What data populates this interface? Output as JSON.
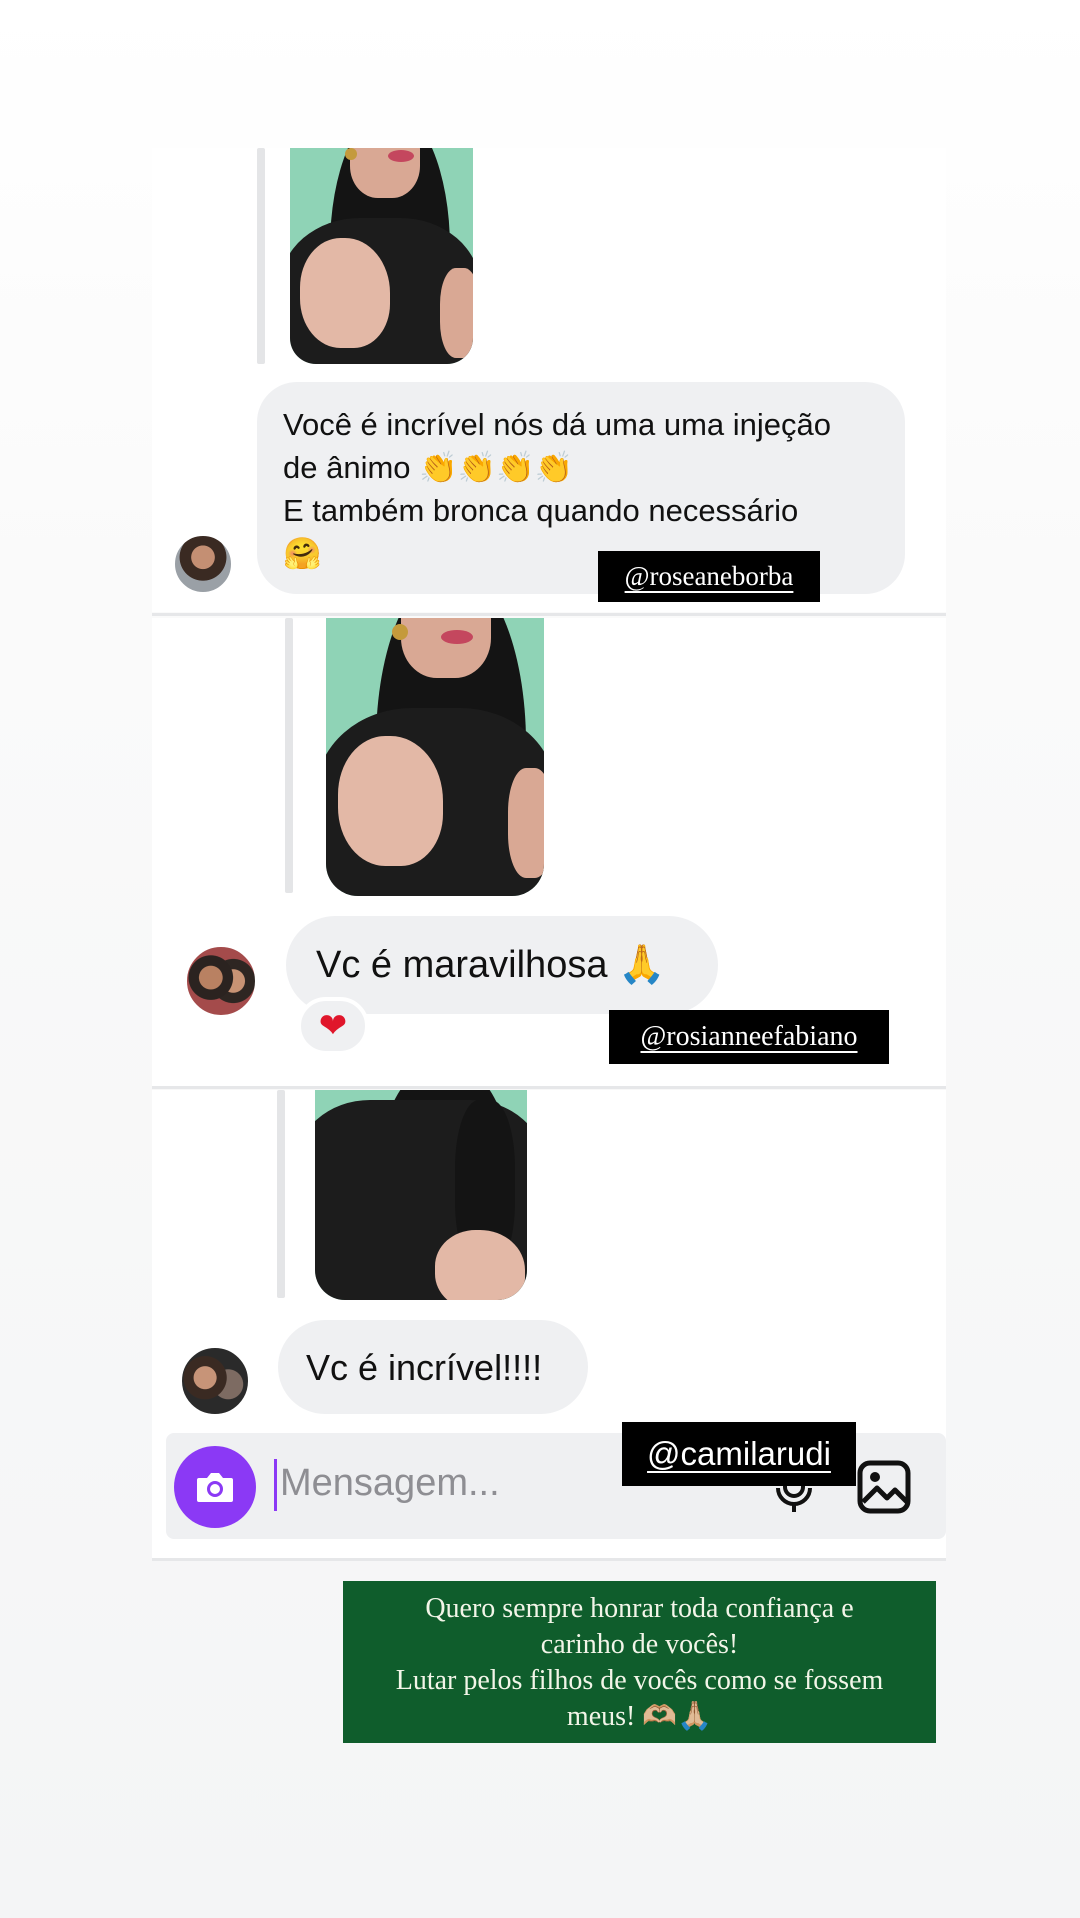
{
  "messages": [
    {
      "lines": [
        "Você é incrível nós dá uma uma injeção",
        "de ânimo 👏👏👏👏",
        "E também bronca quando necessário",
        "🤗"
      ],
      "tag": "@roseaneborba"
    },
    {
      "lines": [
        "Vc é maravilhosa 🙏"
      ],
      "reaction": "❤",
      "tag": "@rosianneefabiano"
    },
    {
      "lines": [
        "Vc é incrível!!!!"
      ],
      "tag": "@camilarudi"
    }
  ],
  "composer": {
    "placeholder": "Mensagem...",
    "camera_icon": "camera-icon",
    "mic_icon": "microphone-icon",
    "gallery_icon": "image-icon"
  },
  "caption": {
    "lines": [
      "Quero sempre honrar toda confiança e",
      "carinho de vocês!",
      "Lutar pelos filhos de vocês como se fossem",
      "meus! 🫶🏼🙏🏼"
    ]
  },
  "colors": {
    "accent": "#8b39f5",
    "caption_bg": "#0f5d2c",
    "bubble_bg": "#eff0f2",
    "reaction": "#e0162b"
  }
}
